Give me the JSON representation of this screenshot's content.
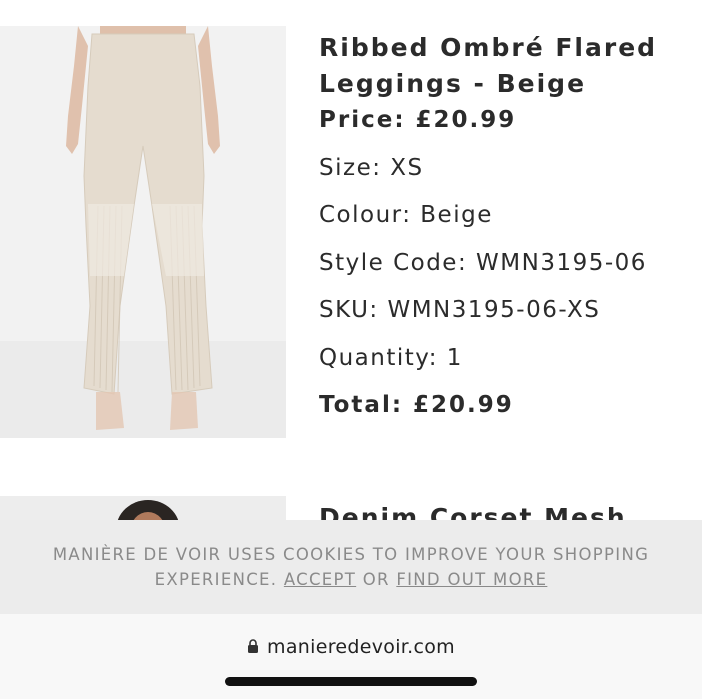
{
  "products": [
    {
      "title_line1": "Ribbed Ombré Flared",
      "title_line2": "Leggings - Beige",
      "price": "Price: £20.99",
      "size": "Size: XS",
      "colour": "Colour: Beige",
      "style_code": "Style Code: WMN3195-06",
      "sku": "SKU: WMN3195-06-XS",
      "quantity": "Quantity: 1",
      "total": "Total: £20.99"
    },
    {
      "title_line1": "Denim Corset Mesh"
    }
  ],
  "cookie_banner": {
    "line1": "MANIÈRE DE VOIR USES COOKIES TO IMPROVE YOUR SHOPPING",
    "line2_prefix": "EXPERIENCE.",
    "accept": "ACCEPT",
    "or": "OR",
    "find_out_more": "FIND OUT MORE"
  },
  "browser": {
    "url": "manieredevoir.com"
  },
  "colors": {
    "product_beige": "#e3d9cc",
    "banner_bg": "#ececec",
    "banner_text": "#8a8a8a"
  }
}
